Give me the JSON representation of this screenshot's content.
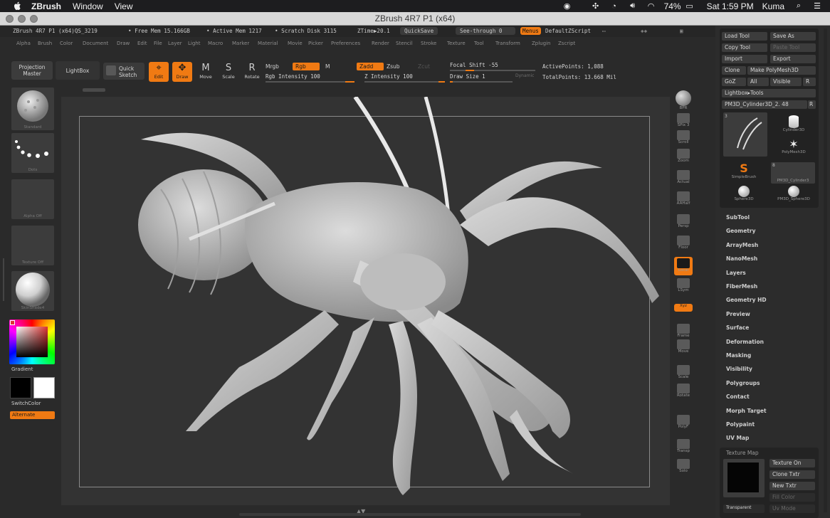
{
  "mac_menubar": {
    "app_name": "ZBrush",
    "menus": [
      "Window",
      "View"
    ],
    "battery": "74%",
    "clock": "Sat 1:59 PM",
    "user": "Kuma"
  },
  "window": {
    "title": "ZBrush 4R7 P1 (x64)"
  },
  "status": {
    "version": "ZBrush 4R7 P1 (x64)QS_3219",
    "free_mem": "• Free Mem 15.166GB",
    "active_mem": "• Active Mem 1217",
    "scratch_disk": "• Scratch Disk 3115",
    "ztime": "ZTime▶20.1",
    "quicksave": "QuickSave",
    "see_through": "See-through  0",
    "menus": "Menus",
    "default_zscript": "DefaultZScript"
  },
  "menu_items": [
    "Alpha",
    "Brush",
    "Color",
    "Document",
    "Draw",
    "Edit",
    "File",
    "Layer",
    "Light",
    "Macro",
    "Marker",
    "Material",
    "Movie",
    "Picker",
    "Preferences",
    "Render",
    "Stencil",
    "Stroke",
    "Texture",
    "Tool",
    "Transform",
    "Zplugin",
    "Zscript"
  ],
  "toolbar": {
    "projection_master": [
      "Projection",
      "Master"
    ],
    "lightbox": "LightBox",
    "quick_sketch": [
      "Quick",
      "Sketch"
    ],
    "edit": "Edit",
    "draw": "Draw",
    "move": "Move",
    "scale": "Scale",
    "rotate": "Rotate",
    "mrgb": "Mrgb",
    "rgb": "Rgb",
    "m": "M",
    "zadd": "Zadd",
    "zsub": "Zsub",
    "zcut": "Zcut",
    "rgb_intensity": "Rgb  Intensity 100",
    "z_intensity": "Z  Intensity 100",
    "focal_shift": "Focal Shift -55",
    "draw_size": "Draw Size 1",
    "dynamic": "Dynamic",
    "active_points": "ActivePoints: 1,088",
    "total_points": "TotalPoints: 13.668 Mil"
  },
  "left_shelf": {
    "brush": "Standard",
    "stroke": "Dots",
    "alpha": "Alpha Off",
    "texture": "Texture Off",
    "material": "SkinShade4",
    "gradient": "Gradient",
    "switchcolor": "SwitchColor",
    "alternate": "Alternate"
  },
  "right_shelf": [
    "BPR",
    "SPix",
    "Scroll",
    "Zoom",
    "Actual",
    "AAHalf",
    "Persp",
    "Floor",
    "Local",
    "LSym",
    "Xyz",
    "Frame",
    "Move",
    "Scale",
    "Rotate",
    "PolyF",
    "Transp",
    "Solo"
  ],
  "right_shelf_spix": "SPix 3",
  "tool_panel": {
    "load_tool": "Load Tool",
    "save_as": "Save As",
    "copy_tool": "Copy Tool",
    "paste_tool": "Paste Tool",
    "import": "Import",
    "export": "Export",
    "clone": "Clone",
    "make_polymesh": "Make PolyMesh3D",
    "goz": "GoZ",
    "all": "All",
    "visible": "Visible",
    "r": "R",
    "lightbox_tools": "Lightbox▸Tools",
    "current_tool": "PM3D_Cylinder3D_2. 48",
    "slot_count": "3",
    "slot_count2": "8",
    "tools": [
      "Cylinder3D",
      "PolyMesh3D",
      "SimpleBrush",
      "PM3D_Cylinder3",
      "Sphere3D",
      "PM3D_Sphere3D"
    ],
    "sections": [
      "SubTool",
      "Geometry",
      "ArrayMesh",
      "NanoMesh",
      "Layers",
      "FiberMesh",
      "Geometry HD",
      "Preview",
      "Surface",
      "Deformation",
      "Masking",
      "Visibility",
      "Polygroups",
      "Contact",
      "Morph Target",
      "Polypaint",
      "UV Map"
    ],
    "texture_map": "Texture Map",
    "texture_on": "Texture On",
    "clone_txtr": "Clone Txtr",
    "new_txtr": "New Txtr",
    "fill_color": "Fill Color",
    "transparent": "Transparent",
    "uv_mode": "Uv Mode"
  },
  "colors": {
    "accent": "#f07a13",
    "panel": "#2a2a2a",
    "canvas": "#333333",
    "model": "#c8c8c8"
  }
}
